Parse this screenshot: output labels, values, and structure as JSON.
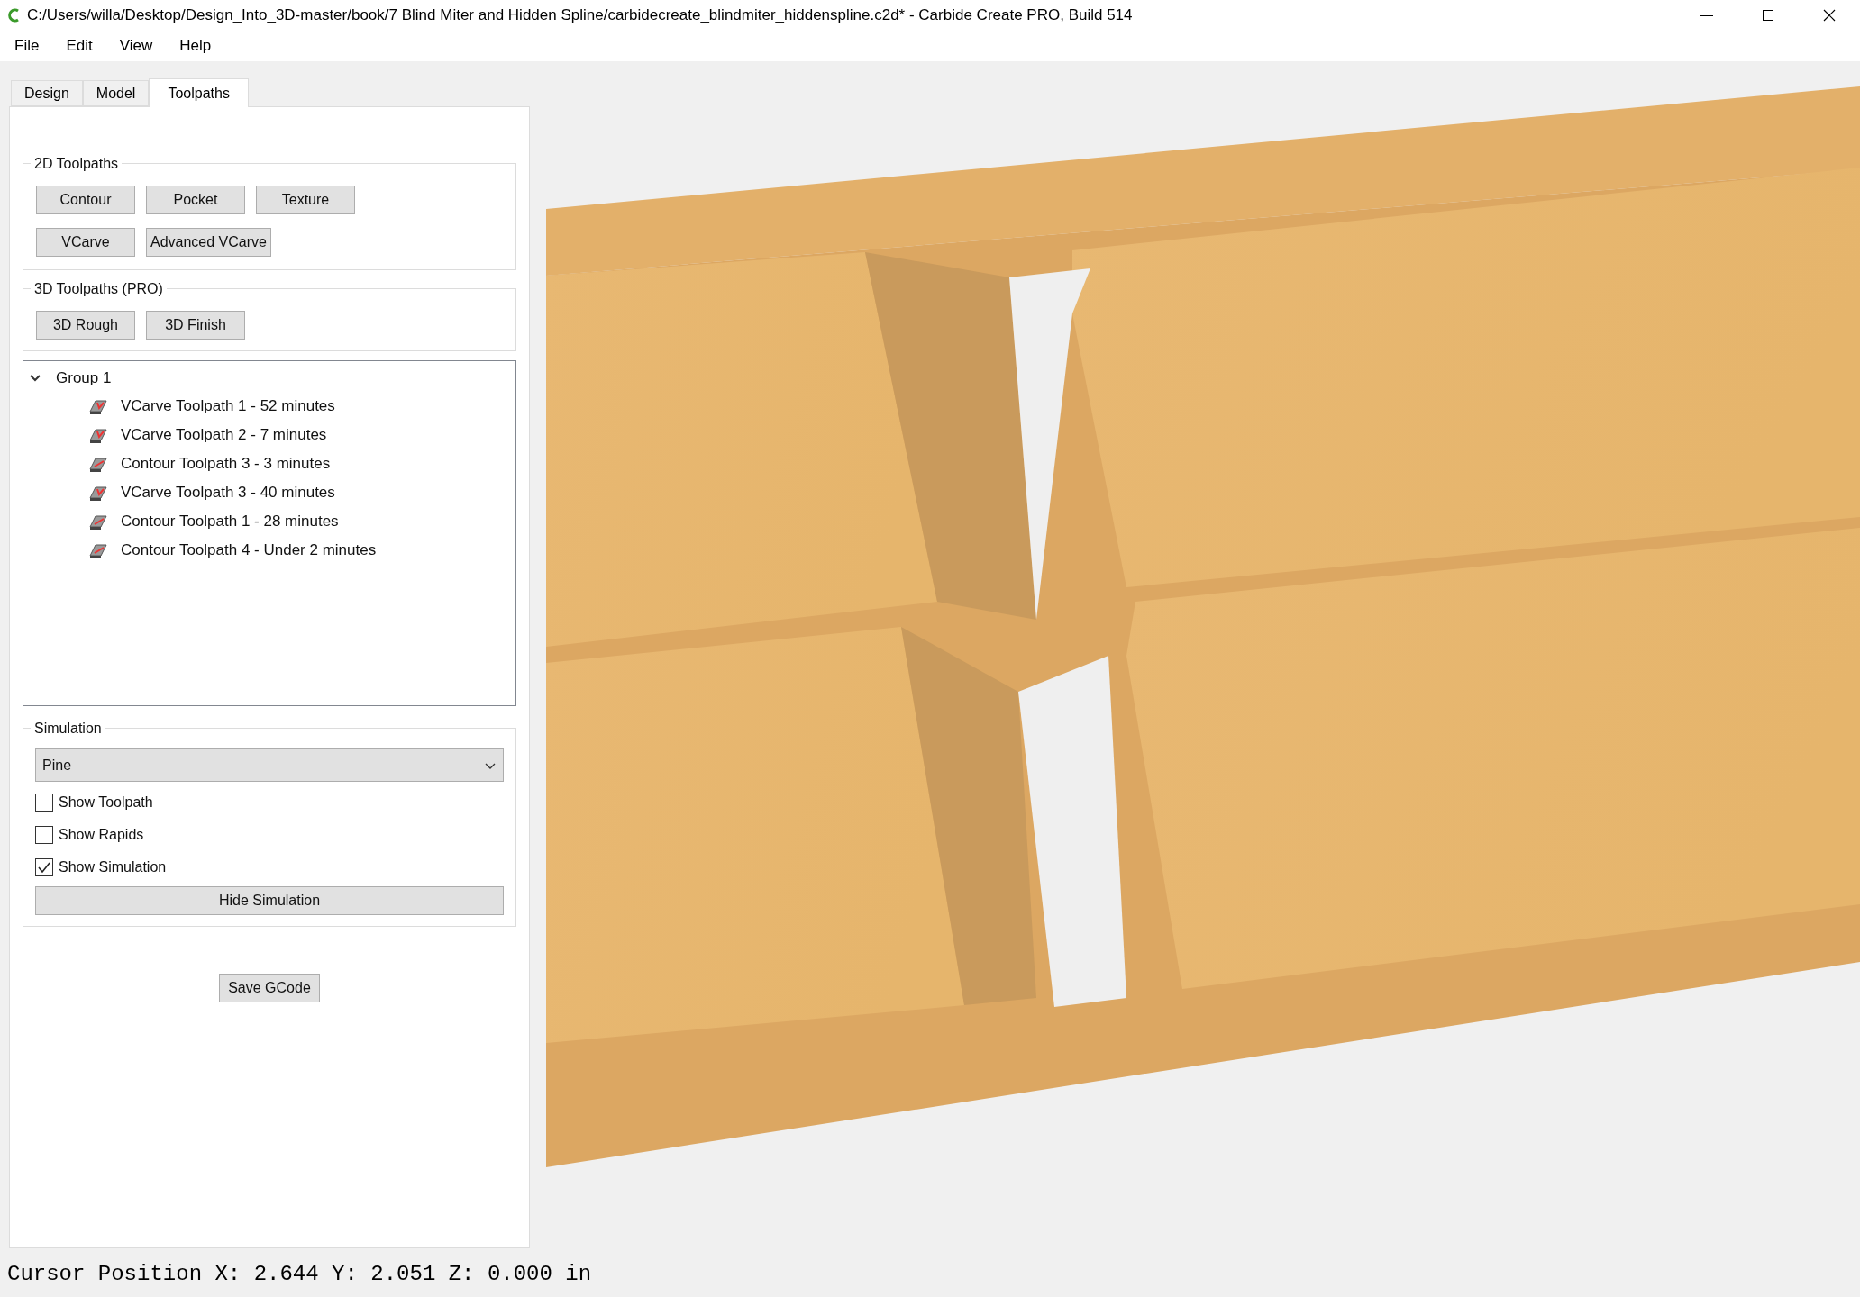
{
  "window": {
    "title": "C:/Users/willa/Desktop/Design_Into_3D-master/book/7 Blind Miter and Hidden Spline/carbidecreate_blindmiter_hiddenspline.c2d* - Carbide Create PRO, Build 514"
  },
  "menu": [
    "File",
    "Edit",
    "View",
    "Help"
  ],
  "tabs": [
    {
      "label": "Design",
      "selected": false
    },
    {
      "label": "Model",
      "selected": false
    },
    {
      "label": "Toolpaths",
      "selected": true
    }
  ],
  "toolpaths_2d": {
    "title": "2D Toolpaths",
    "buttons": [
      "Contour",
      "Pocket",
      "Texture",
      "VCarve",
      "Advanced VCarve"
    ]
  },
  "toolpaths_3d": {
    "title": "3D Toolpaths (PRO)",
    "buttons": [
      "3D Rough",
      "3D Finish"
    ]
  },
  "tree": {
    "group": "Group 1",
    "expanded": true,
    "items": [
      {
        "kind": "vcarve",
        "label": "VCarve Toolpath 1 - 52 minutes"
      },
      {
        "kind": "vcarve",
        "label": "VCarve Toolpath 2 - 7 minutes"
      },
      {
        "kind": "contour",
        "label": "Contour Toolpath 3 - 3 minutes"
      },
      {
        "kind": "vcarve",
        "label": "VCarve Toolpath 3 - 40 minutes"
      },
      {
        "kind": "contour",
        "label": "Contour Toolpath 1 - 28 minutes"
      },
      {
        "kind": "contour",
        "label": "Contour Toolpath 4 - Under 2 minutes"
      }
    ]
  },
  "simulation": {
    "title": "Simulation",
    "material": "Pine",
    "options": [
      {
        "label": "Show Toolpath",
        "checked": false
      },
      {
        "label": "Show Rapids",
        "checked": false
      },
      {
        "label": "Show Simulation",
        "checked": true
      }
    ],
    "button": "Hide Simulation"
  },
  "save_button": "Save GCode",
  "status_bar": "Cursor Position X: 2.644 Y: 2.051 Z: 0.000 in"
}
